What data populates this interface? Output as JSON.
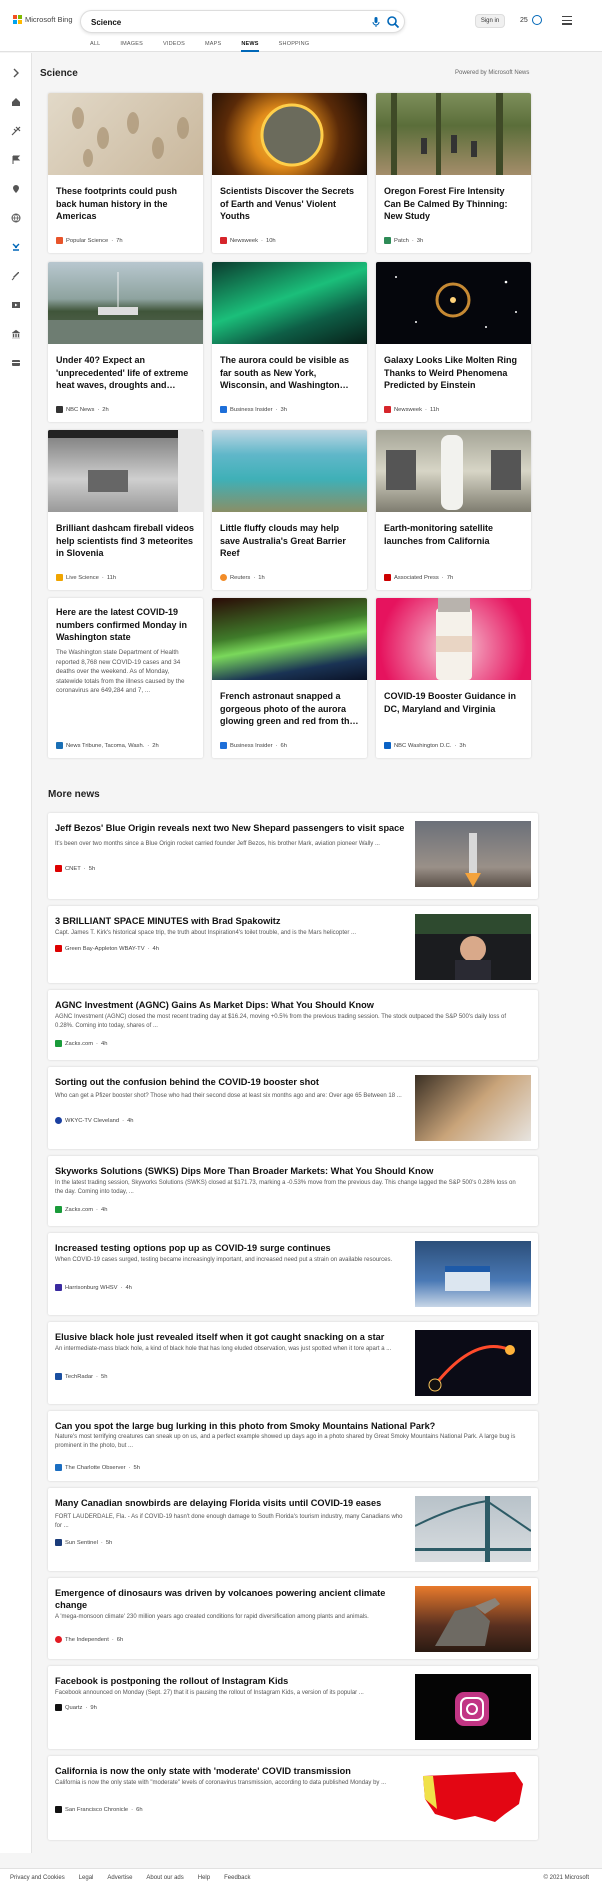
{
  "header": {
    "logo_text": "Microsoft Bing",
    "search_value": "Science",
    "sign_in": "Sign in",
    "rewards_count": "25",
    "tabs": [
      {
        "label": "ALL"
      },
      {
        "label": "IMAGES"
      },
      {
        "label": "VIDEOS"
      },
      {
        "label": "MAPS"
      },
      {
        "label": "NEWS"
      },
      {
        "label": "SHOPPING"
      }
    ],
    "active_tab": "NEWS",
    "accent_color": "#0067b8"
  },
  "sidebar": {
    "icons": [
      "chevron-right-icon",
      "home-icon",
      "transport-icon",
      "flag-icon",
      "location-icon",
      "globe-icon",
      "science-icon",
      "rocket-icon",
      "media-icon",
      "finance-icon",
      "card-icon"
    ]
  },
  "science": {
    "title": "Science",
    "powered_by": "Powered by Microsoft News",
    "cards": [
      {
        "title": "These footprints could push back human history in the Americas",
        "source": "Popular Science",
        "age": "7h"
      },
      {
        "title": "Scientists Discover the Secrets of Earth and Venus' Violent Youths",
        "source": "Newsweek",
        "age": "10h"
      },
      {
        "title": "Oregon Forest Fire Intensity Can Be Calmed By Thinning: New Study",
        "source": "Patch",
        "age": "3h"
      },
      {
        "title": "Under 40? Expect an 'unprecedented' life of extreme heat waves, droughts and…",
        "source": "NBC News",
        "age": "2h"
      },
      {
        "title": "The aurora could be visible as far south as New York, Wisconsin, and Washington…",
        "source": "Business Insider",
        "age": "3h"
      },
      {
        "title": "Galaxy Looks Like Molten Ring Thanks to Weird Phenomena Predicted by Einstein",
        "source": "Newsweek",
        "age": "11h"
      },
      {
        "title": "Brilliant dashcam fireball videos help scientists find 3 meteorites in Slovenia",
        "source": "Live Science",
        "age": "11h"
      },
      {
        "title": "Little fluffy clouds may help save Australia's Great Barrier Reef",
        "source": "Reuters",
        "age": "1h"
      },
      {
        "title": "Earth-monitoring satellite launches from California",
        "source": "Associated Press",
        "age": "7h"
      },
      {
        "title": "Here are the latest COVID-19 numbers confirmed Monday in Washington state",
        "description": "The Washington state Department of Health reported 8,768 new COVID-19 cases and 34 deaths over the weekend. As of Monday, statewide totals from the illness caused by the coronavirus are 649,284 and 7, ...",
        "source": "News Tribune, Tacoma, Wash.",
        "age": "2h"
      },
      {
        "title": "French astronaut snapped a gorgeous photo of the aurora glowing green and red from th…",
        "source": "Business Insider",
        "age": "6h"
      },
      {
        "title": "COVID-19 Booster Guidance in DC, Maryland and Virginia",
        "source": "NBC Washington D.C.",
        "age": "3h"
      }
    ]
  },
  "more_news": {
    "title": "More news",
    "items": [
      {
        "title": "Jeff Bezos' Blue Origin reveals next two New Shepard passengers to visit space",
        "description": "It's been over two months since a Blue Origin rocket carried founder Jeff Bezos, his brother Mark, aviation pioneer Wally ...",
        "source": "CNET",
        "age": "5h"
      },
      {
        "title": "3 BRILLIANT SPACE MINUTES with Brad Spakowitz",
        "description": "Capt. James T. Kirk's historical space trip, the truth about Inspiration4's toilet trouble, and is the Mars helicopter ...",
        "source": "Green Bay-Appleton WBAY-TV",
        "age": "4h"
      },
      {
        "title": "AGNC Investment (AGNC) Gains As Market Dips: What You Should Know",
        "description": "AGNC Investment (AGNC) closed the most recent trading day at $16.24, moving +0.5% from the previous trading session. The stock outpaced the S&P 500's daily loss of 0.28%. Coming into today, shares of ...",
        "source": "Zacks.com",
        "age": "4h"
      },
      {
        "title": "Sorting out the confusion behind the COVID-19 booster shot",
        "description": "Who can get a Pfizer booster shot? Those who had their second dose at least six months ago and are: Over age 65 Between 18 ...",
        "source": "WKYC-TV Cleveland",
        "age": "4h"
      },
      {
        "title": "Skyworks Solutions (SWKS) Dips More Than Broader Markets: What You Should Know",
        "description": "In the latest trading session, Skyworks Solutions (SWKS) closed at $171.73, marking a -0.53% move from the previous day. This change lagged the S&P 500's 0.28% loss on the day. Coming into today, ...",
        "source": "Zacks.com",
        "age": "4h"
      },
      {
        "title": "Increased testing options pop up as COVID-19 surge continues",
        "description": "When COVID-19 cases surged, testing became increasingly important, and increased need put a strain on available resources.",
        "source": "Harrisonburg WHSV",
        "age": "4h"
      },
      {
        "title": "Elusive black hole just revealed itself when it got caught snacking on a star",
        "description": "An intermediate-mass black hole, a kind of black hole that has long eluded observation, was just spotted when it tore apart a ...",
        "source": "TechRadar",
        "age": "5h"
      },
      {
        "title": "Can you spot the large bug lurking in this photo from Smoky Mountains National Park?",
        "description": "Nature's most terrifying creatures can sneak up on us, and a perfect example showed up days ago in a photo shared by Great Smoky Mountains National Park. A large bug is prominent in the photo, but ...",
        "source": "The Charlotte Observer",
        "age": "5h"
      },
      {
        "title": "Many Canadian snowbirds are delaying Florida visits until COVID-19 eases",
        "description": "FORT LAUDERDALE, Fla. - As if COVID-19 hasn't done enough damage to South Florida's tourism industry, many Canadians who for ...",
        "source": "Sun Sentinel",
        "age": "5h"
      },
      {
        "title": "Emergence of dinosaurs was driven by volcanoes powering ancient climate change",
        "description": "A 'mega-monsoon climate' 230 million years ago created conditions for rapid diversification among plants and animals.",
        "source": "The Independent",
        "age": "6h"
      },
      {
        "title": "Facebook is postponing the rollout of Instagram Kids",
        "description": "Facebook announced on Monday (Sept. 27) that it is pausing the rollout of Instagram Kids, a version of its popular ...",
        "source": "Quartz",
        "age": "9h"
      },
      {
        "title": "California is now the only state with 'moderate' COVID transmission",
        "description": "California is now the only state with \"moderate\" levels of coronavirus transmission, according to data published Monday by ...",
        "source": "San Francisco Chronicle",
        "age": "6h"
      }
    ]
  },
  "footer": {
    "links": [
      "Privacy and Cookies",
      "Legal",
      "Advertise",
      "About our ads",
      "Help",
      "Feedback"
    ],
    "copyright": "© 2021 Microsoft"
  }
}
